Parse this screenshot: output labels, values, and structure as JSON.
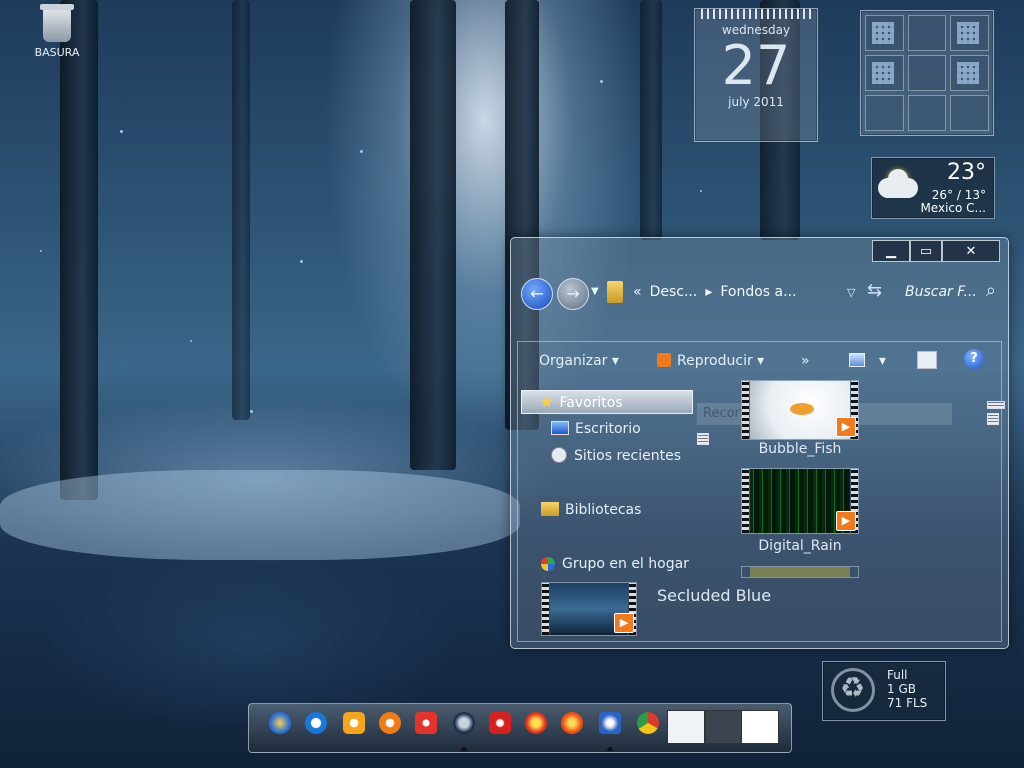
{
  "desktop": {
    "recycle_bin_label": "BASURA"
  },
  "calendar": {
    "weekday": "wednesday",
    "day": "27",
    "month_year": "july 2011"
  },
  "weather": {
    "temperature": "23°",
    "range": "26° / 13°",
    "city": "Mexico C..."
  },
  "explorer": {
    "breadcrumbs": [
      "«",
      "Desc...",
      "▸",
      "Fondos a..."
    ],
    "search_placeholder": "Buscar F...",
    "toolbar": {
      "organize": "Organizar",
      "play": "Reproducir",
      "more": "»"
    },
    "nav": {
      "favorites": "Favoritos",
      "desktop": "Escritorio",
      "recent": "Sitios recientes",
      "libraries": "Bibliotecas",
      "homegroup": "Grupo en el hogar"
    },
    "faded_banner": "Recortado completa",
    "files": [
      {
        "name": "Bubble_Fish"
      },
      {
        "name": "Digital_Rain"
      },
      {
        "name": "Secluded Blue"
      }
    ]
  },
  "recycle_widget": {
    "status": "Full",
    "size": "1 GB",
    "files": "71 FLS"
  },
  "colors": {
    "accent": "#1d56c7",
    "play_badge": "#f27a1c"
  }
}
